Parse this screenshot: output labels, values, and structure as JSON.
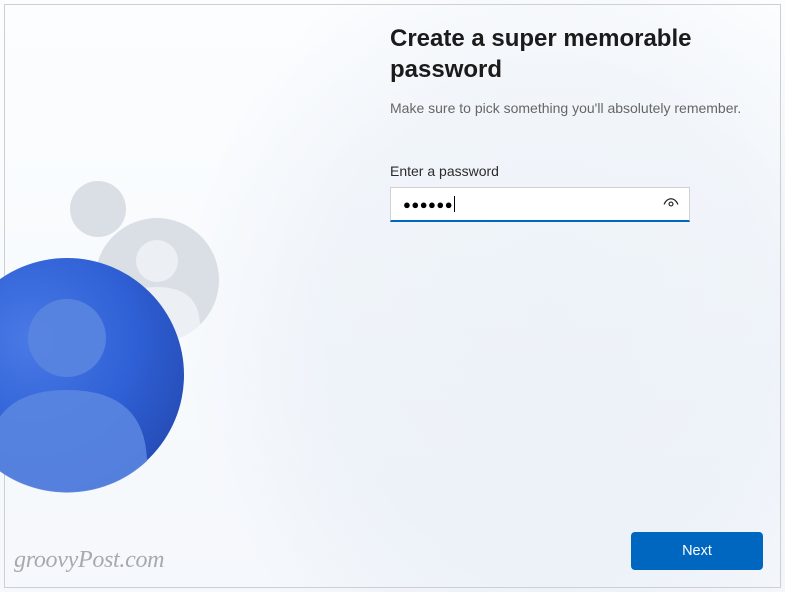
{
  "header": {
    "title": "Create a super memorable password",
    "subtitle": "Make sure to pick something you'll absolutely remember."
  },
  "password": {
    "label": "Enter a password",
    "masked_value": "●●●●●●"
  },
  "actions": {
    "next_label": "Next"
  },
  "watermark": "groovyPost.com"
}
